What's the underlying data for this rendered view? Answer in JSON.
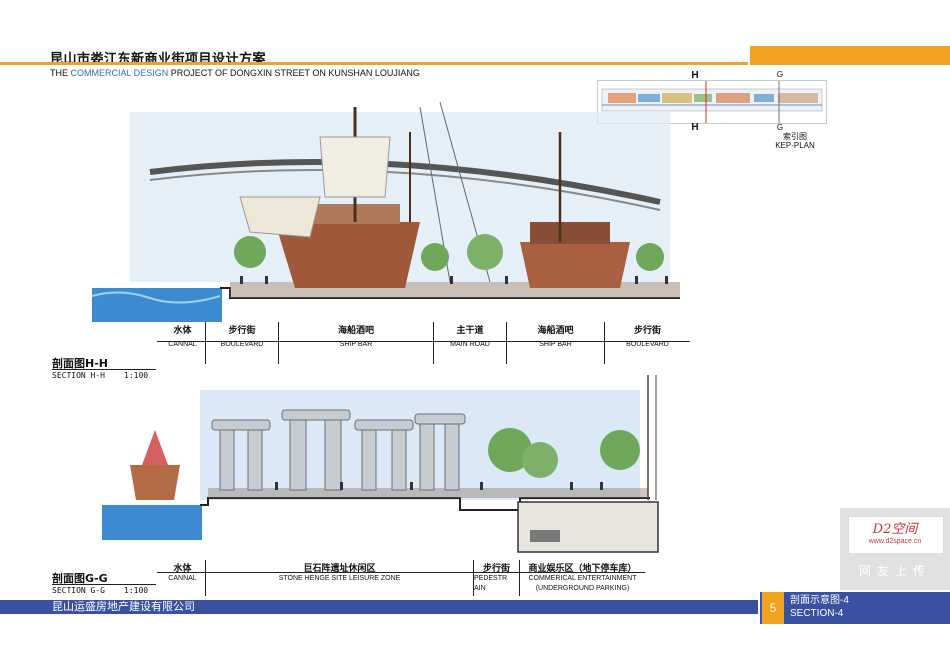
{
  "header": {
    "title_cn": "昆山市娄江东新商业街项目设计方案",
    "title_en_prefix": "THE ",
    "title_en_accent": "COMMERCIAL DESIGN",
    "title_en_suffix": " PROJECT OF DONGXIN STREET ON KUNSHAN LOUJIANG"
  },
  "keyplan": {
    "marker_h_top": "H",
    "marker_h_bottom": "H",
    "marker_g_top": "G",
    "marker_g_bottom": "G",
    "caption_cn": "索引图",
    "caption_en": "KEP-PLAN"
  },
  "section_hh": {
    "label_cn": "剖面图H-H",
    "label_en": "SECTION H-H",
    "scale": "1:100",
    "zones": [
      {
        "cn": "水体",
        "en": "CANNAL"
      },
      {
        "cn": "步行街",
        "en": "BOULEVARD"
      },
      {
        "cn": "海船酒吧",
        "en": "SHIP BAR"
      },
      {
        "cn": "主干道",
        "en": "MAIN ROAD"
      },
      {
        "cn": "海船酒吧",
        "en": "SHIP BAR"
      },
      {
        "cn": "步行街",
        "en": "BOULEVARD"
      }
    ]
  },
  "section_gg": {
    "label_cn": "剖面图G-G",
    "label_en": "SECTION G-G",
    "scale": "1:100",
    "zones": [
      {
        "cn": "水体",
        "en": "CANNAL",
        "en2": ""
      },
      {
        "cn": "巨石阵遗址休闲区",
        "en": "STONE HENGE SITE LEISURE ZONE",
        "en2": ""
      },
      {
        "cn": "步行街",
        "en": "PEDESTR",
        "en2": "AIN"
      },
      {
        "cn": "商业娱乐区（地下停车库）",
        "en": "COMMERICAL ENTERTAINMENT",
        "en2": "(UNDERGROUND PARKING)"
      }
    ]
  },
  "footer": {
    "company": "昆山运盛房地产建设有限公司",
    "page_number": "5",
    "section_cn": "剖面示意图-4",
    "section_en": "SECTION-4"
  },
  "watermark": {
    "logo": "D2空间",
    "url": "www.d2space.cn",
    "caption": "网友上传"
  },
  "colors": {
    "accent_orange": "#f1a31f",
    "footer_blue": "#3a50a0",
    "title_blue": "#2f6fb5"
  }
}
